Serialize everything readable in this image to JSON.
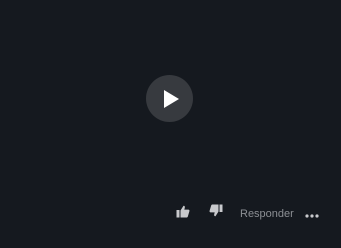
{
  "video": {
    "play_icon": "play-icon"
  },
  "actions": {
    "like_icon": "thumbs-up-icon",
    "dislike_icon": "thumbs-down-icon",
    "reply_label": "Responder",
    "more_icon": "more-horizontal-icon"
  },
  "colors": {
    "background": "#15191f",
    "play_circle": "#373a3f",
    "icon": "#c8c9cc",
    "reply_text": "#8c8f94"
  }
}
